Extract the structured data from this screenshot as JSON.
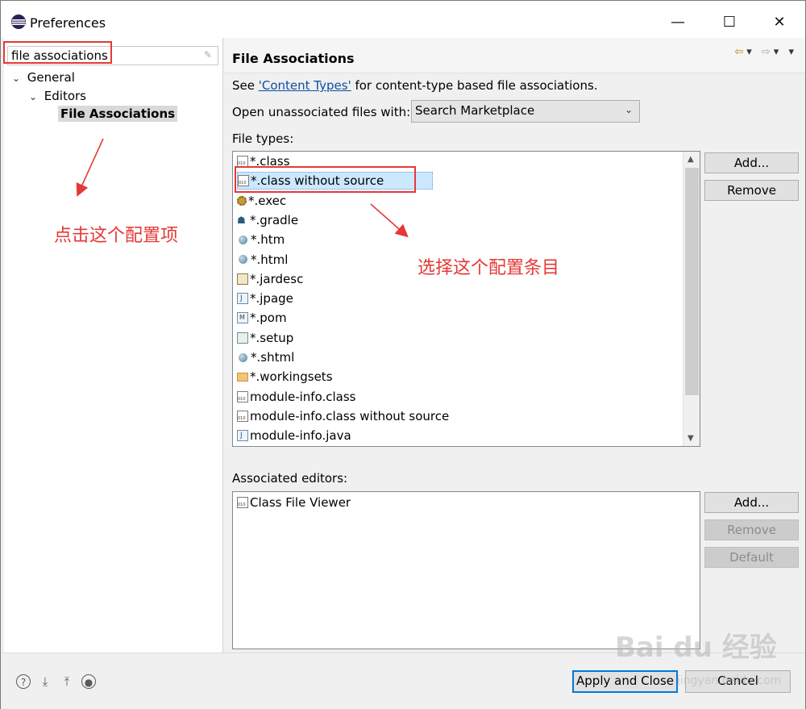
{
  "window": {
    "title": "Preferences",
    "minimize": "—",
    "maximize": "☐",
    "close": "✕"
  },
  "left": {
    "filter_value": "file associations",
    "tree": [
      {
        "label": "General",
        "expanded": true
      },
      {
        "label": "Editors",
        "expanded": true
      },
      {
        "label": "File Associations",
        "selected": true
      }
    ]
  },
  "right": {
    "heading": "File Associations",
    "see_prefix": "See ",
    "see_link": "'Content Types'",
    "see_suffix": " for content-type based file associations.",
    "open_label": "Open unassociated files with:",
    "open_value": "Search Marketplace",
    "file_types_label": "File types:",
    "file_types": [
      {
        "label": "*.class",
        "icon": "doc"
      },
      {
        "label": "*.class without source",
        "icon": "doc"
      },
      {
        "label": "*.exec",
        "icon": "gear"
      },
      {
        "label": "*.gradle",
        "icon": "elephant"
      },
      {
        "label": "*.htm",
        "icon": "globe"
      },
      {
        "label": "*.html",
        "icon": "globe"
      },
      {
        "label": "*.jardesc",
        "icon": "jar"
      },
      {
        "label": "*.jpage",
        "icon": "jfile"
      },
      {
        "label": "*.pom",
        "icon": "mfile"
      },
      {
        "label": "*.setup",
        "icon": "sfile"
      },
      {
        "label": "*.shtml",
        "icon": "globe"
      },
      {
        "label": "*.workingsets",
        "icon": "folder"
      },
      {
        "label": "module-info.class",
        "icon": "doc"
      },
      {
        "label": "module-info.class without source",
        "icon": "doc"
      },
      {
        "label": "module-info.java",
        "icon": "jfile"
      }
    ],
    "selected_file_type": "*.class without source",
    "ft_add": "Add...",
    "ft_remove": "Remove",
    "assoc_label": "Associated editors:",
    "assoc_items": [
      "Class File Viewer"
    ],
    "ed_add": "Add...",
    "ed_remove": "Remove",
    "ed_default": "Default"
  },
  "footer": {
    "apply_close": "Apply and Close",
    "cancel": "Cancel"
  },
  "annotations": {
    "left_note": "点击这个配置项",
    "right_note": "选择这个配置条目",
    "color": "#e53935"
  },
  "watermark": {
    "brand": "Bai du 经验",
    "url": "jingyan.baidu.com"
  },
  "colors": {
    "selection": "#cce8ff",
    "link": "#0c4ea3",
    "focus": "#0078d7"
  }
}
